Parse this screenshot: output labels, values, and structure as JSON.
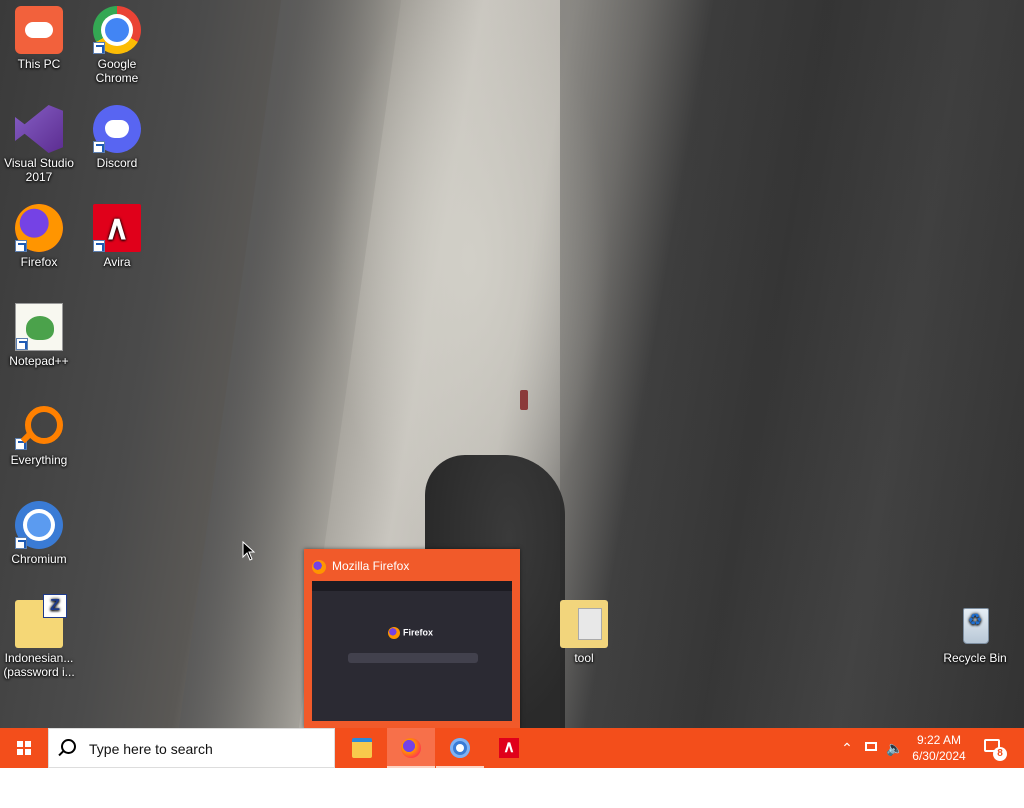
{
  "desktop": {
    "icons": [
      {
        "label": "This PC"
      },
      {
        "label": "Google Chrome"
      },
      {
        "label": "Visual Studio 2017"
      },
      {
        "label": "Discord"
      },
      {
        "label": "Firefox"
      },
      {
        "label": "Avira"
      },
      {
        "label": "Notepad++"
      },
      {
        "label": "Everything"
      },
      {
        "label": "Chromium"
      },
      {
        "label": "Indonesian... (password i..."
      },
      {
        "label": "tool"
      },
      {
        "label": "Recycle Bin"
      }
    ]
  },
  "thumbnail": {
    "title": "Mozilla Firefox",
    "preview_logo": "Firefox"
  },
  "taskbar": {
    "search_placeholder": "Type here to search",
    "apps": [
      "File Explorer",
      "Firefox",
      "Chromium",
      "Avira"
    ],
    "tray": {
      "time": "9:22 AM",
      "date": "6/30/2024",
      "notification_count": "8"
    }
  },
  "colors": {
    "taskbar": "#f34e1b",
    "thumbnail_frame": "#f15a2a"
  }
}
